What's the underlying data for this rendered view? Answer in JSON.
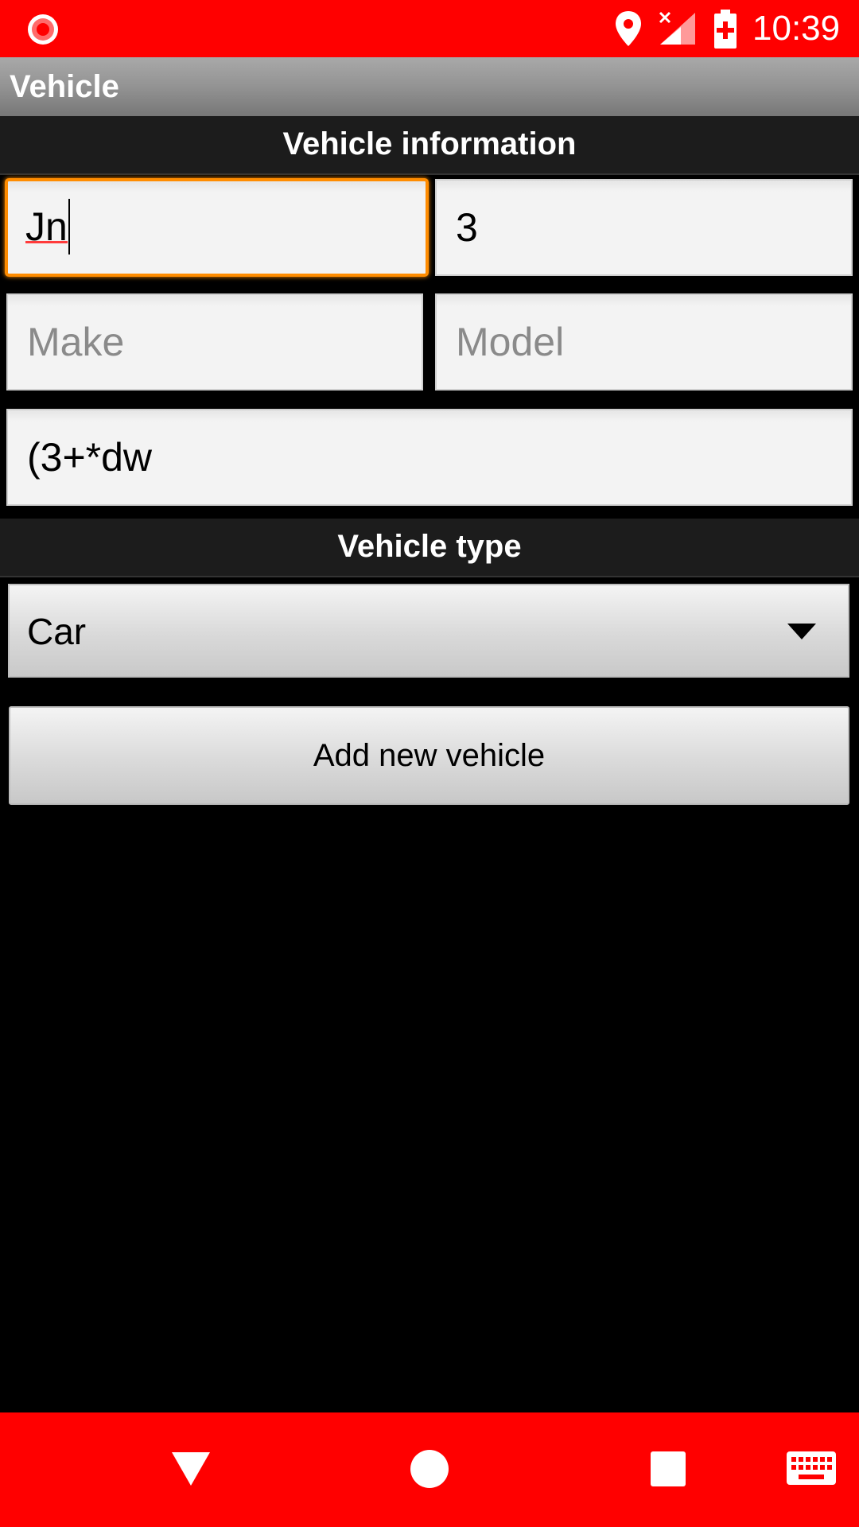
{
  "status_bar": {
    "time": "10:39",
    "bg_color": "#ff0000",
    "icons": [
      "record-icon",
      "location-icon",
      "signal-no-data-icon",
      "battery-charging-icon"
    ]
  },
  "app": {
    "title": "Vehicle"
  },
  "sections": {
    "vehicle_information": "Vehicle information",
    "vehicle_type": "Vehicle type"
  },
  "fields": {
    "field1": {
      "value": "Jn",
      "placeholder": "",
      "focused": true
    },
    "field2": {
      "value": "3",
      "placeholder": ""
    },
    "make": {
      "value": "",
      "placeholder": "Make"
    },
    "model": {
      "value": "",
      "placeholder": "Model"
    },
    "field5": {
      "value": "(3+*dw",
      "placeholder": ""
    }
  },
  "vehicle_type_spinner": {
    "selected": "Car"
  },
  "buttons": {
    "add_label": "Add new vehicle"
  },
  "nav_bar": {
    "icons": [
      "back-icon",
      "home-icon",
      "recents-icon",
      "keyboard-icon"
    ],
    "bg_color": "#ff0000"
  },
  "colors": {
    "focus_accent": "#ff8c00",
    "system_bars": "#ff0000",
    "spell_underline": "#ff3b3b"
  }
}
